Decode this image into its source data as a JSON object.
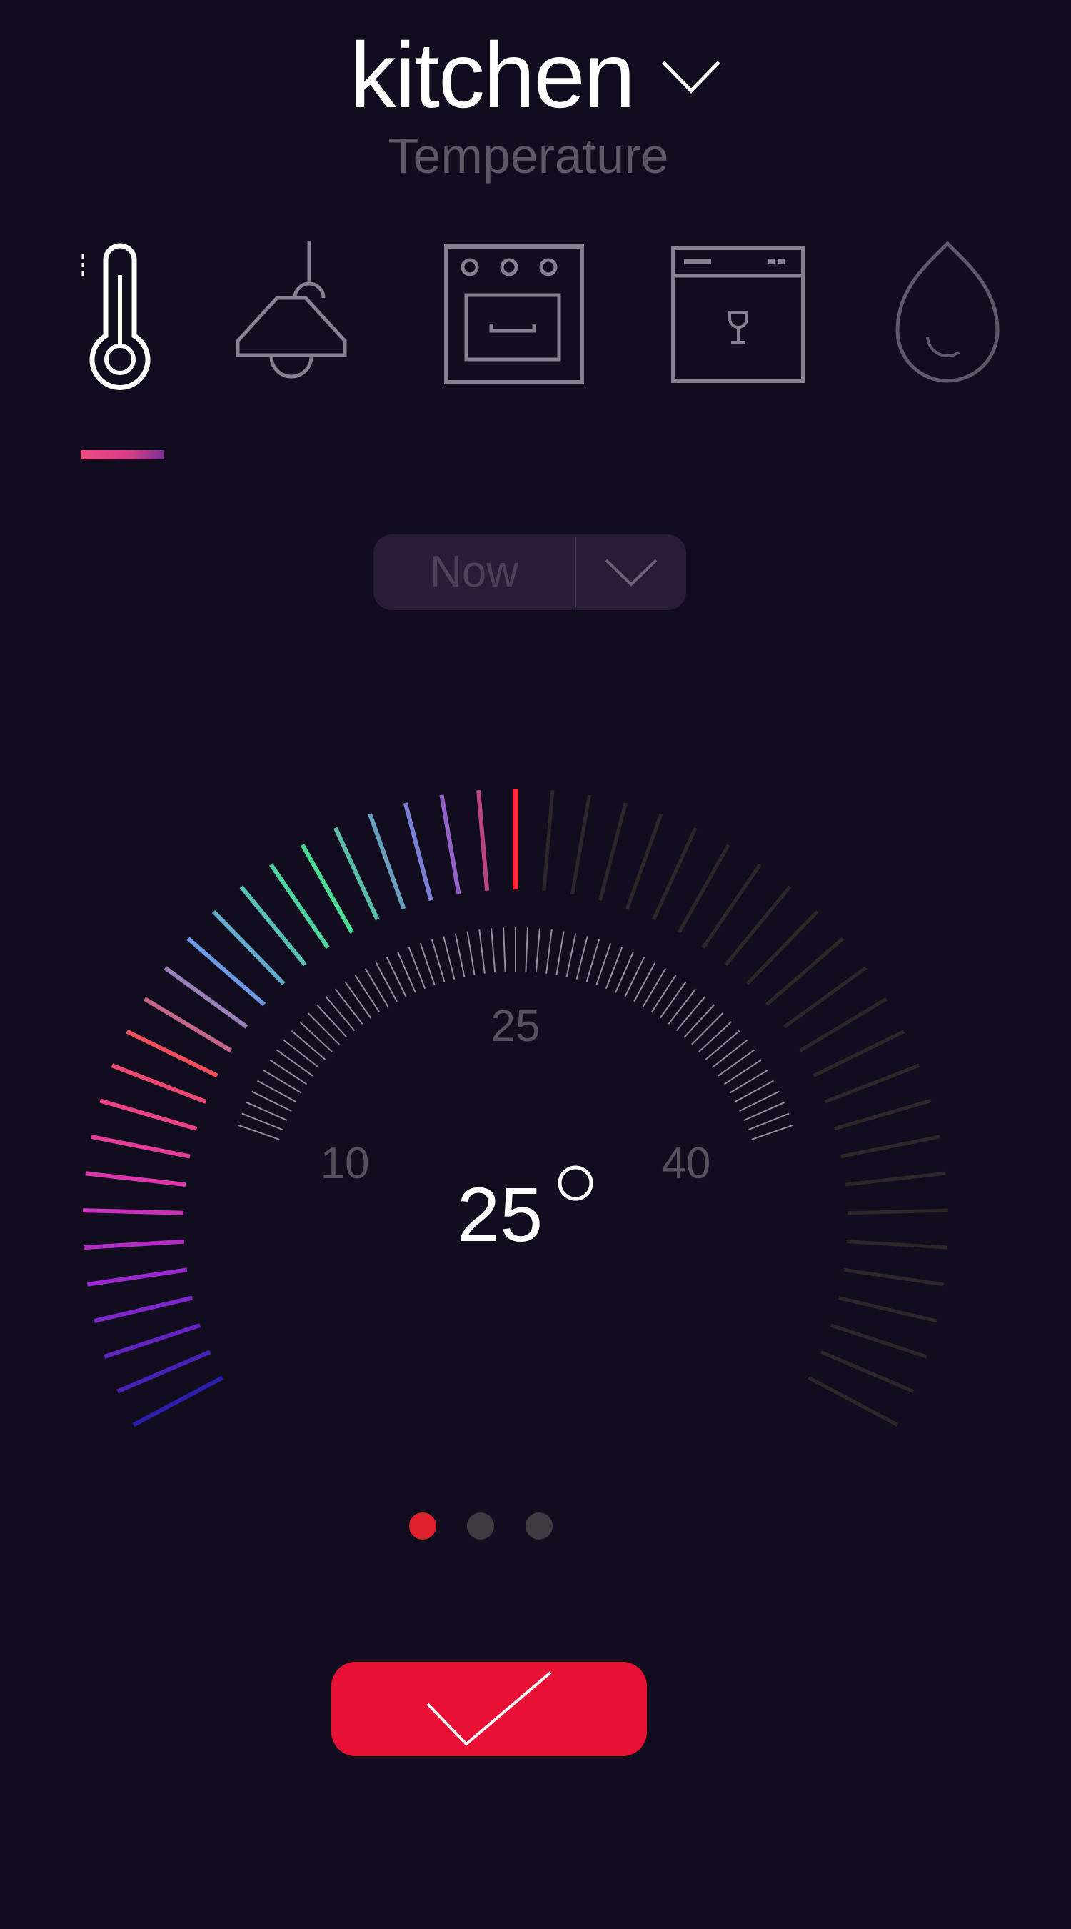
{
  "header": {
    "room": "kitchen",
    "subtitle": "Temperature"
  },
  "categories": [
    {
      "name": "thermometer-icon",
      "label": "Temperature",
      "active": true
    },
    {
      "name": "ceiling-lamp-icon",
      "label": "Light",
      "active": false
    },
    {
      "name": "oven-icon",
      "label": "Oven",
      "active": false
    },
    {
      "name": "wine-fridge-icon",
      "label": "Wine cooler",
      "active": false
    },
    {
      "name": "water-drop-icon",
      "label": "Humidity",
      "active": false
    }
  ],
  "time_selector": {
    "value": "Now"
  },
  "thermostat": {
    "value": 25,
    "value_text": "25",
    "scale_labels": {
      "low": "10",
      "mid": "25",
      "high": "40"
    },
    "min": 0,
    "max": 50
  },
  "pagination": {
    "count": 3,
    "active_index": 0
  },
  "colors": {
    "background": "#110d1e",
    "accent": "#e81135",
    "active_dot": "#e0212c",
    "inactive_dot": "#3d3a40",
    "icon_inactive": "#858190"
  },
  "icons": {
    "room_dropdown": "chevron-down-icon",
    "time_dropdown": "chevron-down-icon",
    "confirm": "checkmark-icon"
  }
}
